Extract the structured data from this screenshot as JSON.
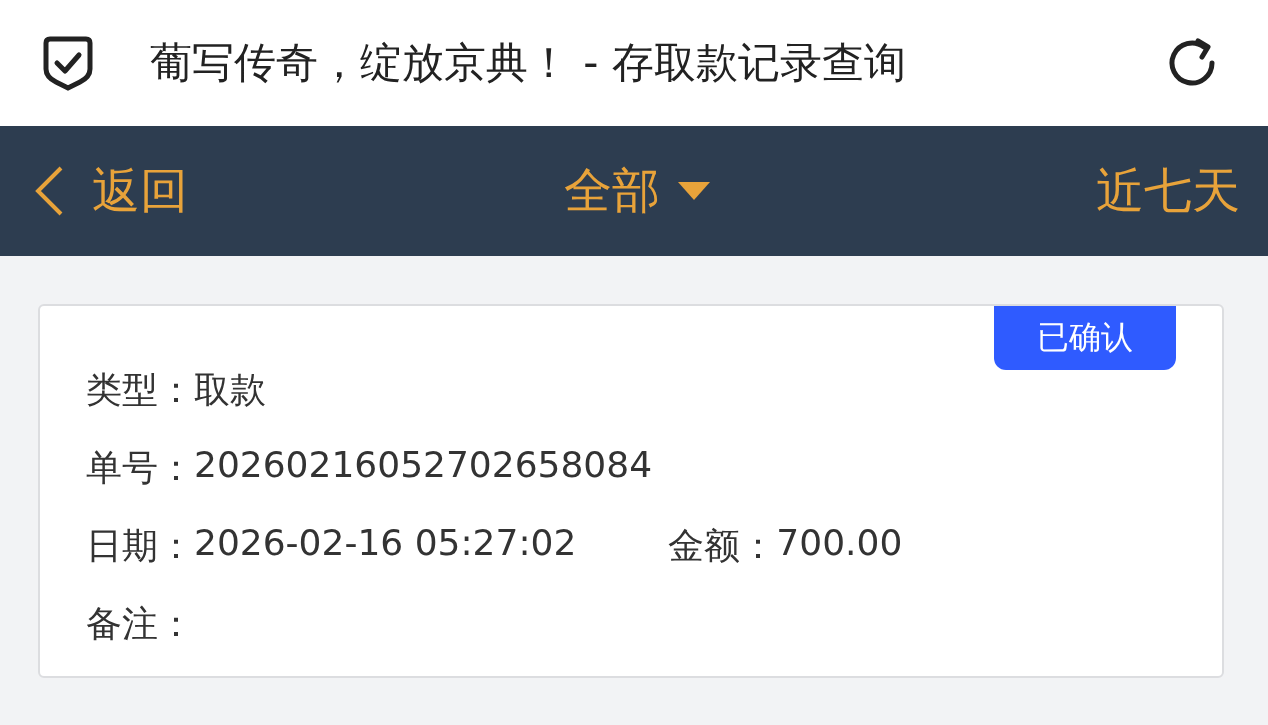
{
  "header": {
    "title": "葡写传奇，绽放京典！ - 存取款记录查询"
  },
  "nav": {
    "back": "返回",
    "filter": "全部",
    "range": "近七天"
  },
  "records": [
    {
      "status": "已确认",
      "rows": [
        [
          {
            "label": "类型：",
            "value": "取款"
          }
        ],
        [
          {
            "label": "单号：",
            "value": "20260216052702658084"
          }
        ],
        [
          {
            "label": "日期：",
            "value": "2026-02-16 05:27:02"
          },
          {
            "label": "金额：",
            "value": "700.00"
          }
        ],
        [
          {
            "label": "备注："
          }
        ]
      ]
    }
  ]
}
